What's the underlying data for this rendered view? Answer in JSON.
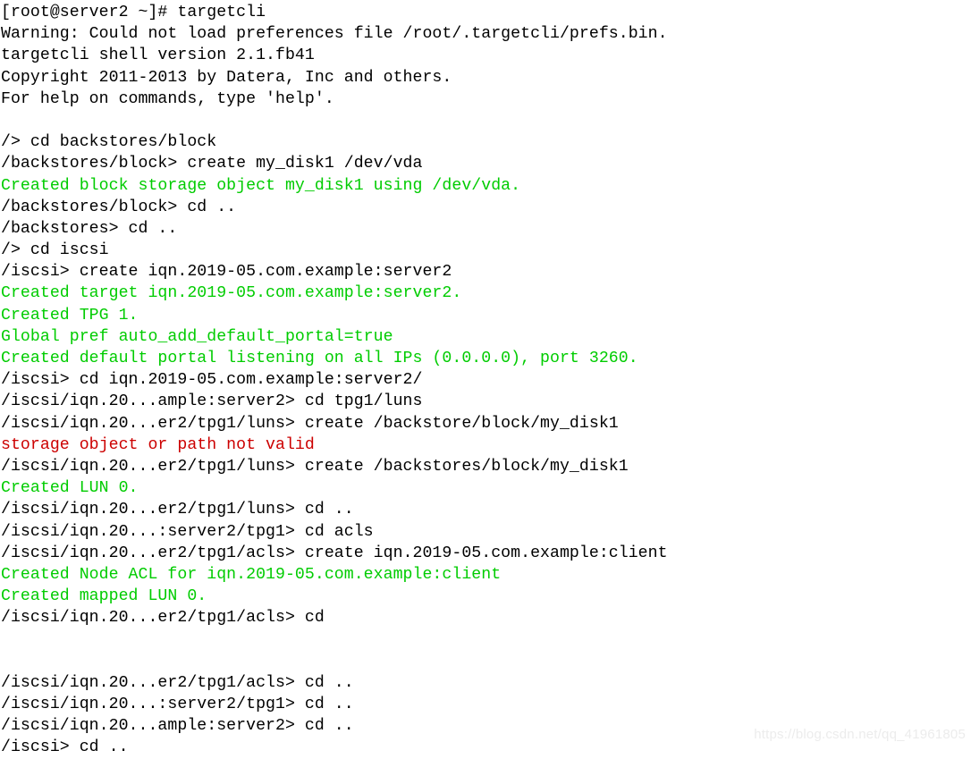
{
  "terminal": {
    "app": "targetcli",
    "colors": {
      "background": "#ffffff",
      "default_text": "#000000",
      "success_text": "#00cc00",
      "error_text": "#cc0000",
      "watermark_text": "#ececec"
    },
    "lines": [
      {
        "text": "[root@server2 ~]# targetcli",
        "color": "default"
      },
      {
        "text": "Warning: Could not load preferences file /root/.targetcli/prefs.bin.",
        "color": "default"
      },
      {
        "text": "targetcli shell version 2.1.fb41",
        "color": "default"
      },
      {
        "text": "Copyright 2011-2013 by Datera, Inc and others.",
        "color": "default"
      },
      {
        "text": "For help on commands, type 'help'.",
        "color": "default"
      },
      {
        "text": "",
        "color": "blank"
      },
      {
        "text": "/> cd backstores/block",
        "color": "default"
      },
      {
        "text": "/backstores/block> create my_disk1 /dev/vda",
        "color": "default"
      },
      {
        "text": "Created block storage object my_disk1 using /dev/vda.",
        "color": "green"
      },
      {
        "text": "/backstores/block> cd ..",
        "color": "default"
      },
      {
        "text": "/backstores> cd ..",
        "color": "default"
      },
      {
        "text": "/> cd iscsi",
        "color": "default"
      },
      {
        "text": "/iscsi> create iqn.2019-05.com.example:server2",
        "color": "default"
      },
      {
        "text": "Created target iqn.2019-05.com.example:server2.",
        "color": "green"
      },
      {
        "text": "Created TPG 1.",
        "color": "green"
      },
      {
        "text": "Global pref auto_add_default_portal=true",
        "color": "green"
      },
      {
        "text": "Created default portal listening on all IPs (0.0.0.0), port 3260.",
        "color": "green"
      },
      {
        "text": "/iscsi> cd iqn.2019-05.com.example:server2/",
        "color": "default"
      },
      {
        "text": "/iscsi/iqn.20...ample:server2> cd tpg1/luns",
        "color": "default"
      },
      {
        "text": "/iscsi/iqn.20...er2/tpg1/luns> create /backstore/block/my_disk1",
        "color": "default"
      },
      {
        "text": "storage object or path not valid",
        "color": "red"
      },
      {
        "text": "/iscsi/iqn.20...er2/tpg1/luns> create /backstores/block/my_disk1",
        "color": "default"
      },
      {
        "text": "Created LUN 0.",
        "color": "green"
      },
      {
        "text": "/iscsi/iqn.20...er2/tpg1/luns> cd ..",
        "color": "default"
      },
      {
        "text": "/iscsi/iqn.20...:server2/tpg1> cd acls",
        "color": "default"
      },
      {
        "text": "/iscsi/iqn.20...er2/tpg1/acls> create iqn.2019-05.com.example:client",
        "color": "default"
      },
      {
        "text": "Created Node ACL for iqn.2019-05.com.example:client",
        "color": "green"
      },
      {
        "text": "Created mapped LUN 0.",
        "color": "green"
      },
      {
        "text": "/iscsi/iqn.20...er2/tpg1/acls> cd",
        "color": "default"
      },
      {
        "text": "",
        "color": "blank"
      },
      {
        "text": "",
        "color": "blank"
      },
      {
        "text": "/iscsi/iqn.20...er2/tpg1/acls> cd ..",
        "color": "default"
      },
      {
        "text": "/iscsi/iqn.20...:server2/tpg1> cd ..",
        "color": "default"
      },
      {
        "text": "/iscsi/iqn.20...ample:server2> cd ..",
        "color": "default"
      },
      {
        "text": "/iscsi> cd ..",
        "color": "default"
      }
    ]
  },
  "watermark": {
    "text": "https://blog.csdn.net/qq_41961805"
  }
}
